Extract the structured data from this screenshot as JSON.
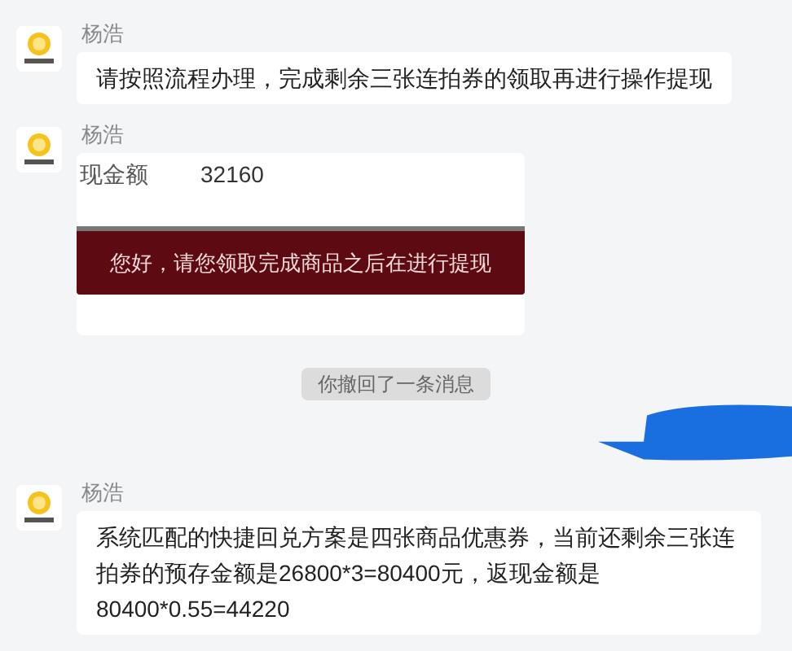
{
  "messages": [
    {
      "kind": "text",
      "sender": "杨浩",
      "text": "请按照流程办理，完成剩余三张连拍券的领取再进行操作提现"
    },
    {
      "kind": "image",
      "sender": "杨浩",
      "label": "现金额",
      "amount": "32160",
      "banner": "您好，请您领取完成商品之后在进行提现"
    },
    {
      "kind": "notice",
      "text": "你撤回了一条消息"
    },
    {
      "kind": "redacted"
    },
    {
      "kind": "text",
      "sender": "杨浩",
      "text": "系统匹配的快捷回兑方案是四张商品优惠券，当前还剩余三张连拍券的预存金额是26800*3=80400元，返现金额是80400*0.55=44220"
    }
  ]
}
